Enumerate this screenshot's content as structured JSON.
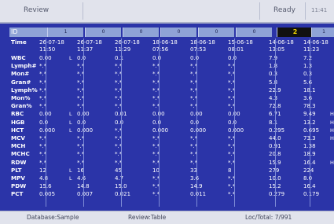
{
  "header": {
    "title": "Review",
    "status": "Ready",
    "time": "11:41"
  },
  "table": {
    "id_label": "ID",
    "ids": [
      "1",
      "0",
      "0",
      "0",
      "0",
      "0",
      "2",
      "1"
    ],
    "selected_index": 6,
    "rows": [
      {
        "param": "Time",
        "values": [
          "26-07-18\n11:50",
          "26-07-18\n11:37",
          "26-07-18\n11:29",
          "18-06-18\n07:56",
          "18-06-18\n07:53",
          "15-06-18\n08:01",
          "14-06-18\n13:05",
          "14-06-18\n11:23"
        ],
        "flags": [
          "",
          "",
          "",
          "",
          "",
          "",
          "",
          ""
        ]
      },
      {
        "param": "WBC",
        "values": [
          "0.00",
          "0.0",
          "0.1",
          "0.0",
          "0.0",
          "0.0",
          "7.9",
          "7.2"
        ],
        "flags": [
          "L",
          "",
          "",
          "",
          "",
          "",
          "",
          ""
        ]
      },
      {
        "param": "Lymph#",
        "values": [
          "*.*",
          "*.*",
          "*.*",
          "*.*",
          "*.*",
          "*.*",
          "1.8",
          "1.3"
        ],
        "flags": [
          "",
          "",
          "",
          "",
          "",
          "",
          "",
          ""
        ]
      },
      {
        "param": "Mon#",
        "values": [
          "*.*",
          "*.*",
          "*.*",
          "*.*",
          "*.*",
          "*.*",
          "0.3",
          "0.3"
        ],
        "flags": [
          "",
          "",
          "",
          "",
          "",
          "",
          "",
          ""
        ]
      },
      {
        "param": "Gran#",
        "values": [
          "*.*",
          "*.*",
          "*.*",
          "*.*",
          "*.*",
          "*.*",
          "5.8",
          "5.6"
        ],
        "flags": [
          "",
          "",
          "",
          "",
          "",
          "",
          "",
          ""
        ]
      },
      {
        "param": "Lymph%",
        "values": [
          "*.*",
          "*.*",
          "*.*",
          "*.*",
          "*.*",
          "*.*",
          "22.9",
          "18.1"
        ],
        "flags": [
          "",
          "",
          "",
          "",
          "",
          "",
          "",
          ""
        ]
      },
      {
        "param": "Mon%",
        "values": [
          "*.*",
          "*.*",
          "*.*",
          "*.*",
          "*.*",
          "*.*",
          "4.3",
          "3.6"
        ],
        "flags": [
          "",
          "",
          "",
          "",
          "",
          "",
          "",
          ""
        ]
      },
      {
        "param": "Gran%",
        "values": [
          "*.*",
          "*.*",
          "*.*",
          "*.*",
          "*.*",
          "*.*",
          "72.8",
          "78.3"
        ],
        "flags": [
          "",
          "",
          "",
          "",
          "",
          "",
          "",
          ""
        ]
      },
      {
        "param": "RBC",
        "values": [
          "0.00",
          "0.00",
          "0.01",
          "0.00",
          "0.00",
          "0.00",
          "6.71",
          "9.49"
        ],
        "flags": [
          "L",
          "",
          "",
          "",
          "",
          "",
          "",
          "H"
        ]
      },
      {
        "param": "HGB",
        "values": [
          "0.0",
          "0.0",
          "0.0",
          "0.0",
          "0.0",
          "0.0",
          "8.1",
          "13.2"
        ],
        "flags": [
          "L",
          "",
          "",
          "",
          "",
          "",
          "",
          "H"
        ]
      },
      {
        "param": "HCT",
        "values": [
          "0.000",
          "0.000",
          "*.*",
          "0.000",
          "0.000",
          "0.000",
          "0.295",
          "0.695"
        ],
        "flags": [
          "L",
          "",
          "",
          "",
          "",
          "",
          "",
          "H"
        ]
      },
      {
        "param": "MCV",
        "values": [
          "*.*",
          "*.*",
          "*.*",
          "*.*",
          "*.*",
          "*.*",
          "44.0",
          "73.3"
        ],
        "flags": [
          "",
          "",
          "",
          "",
          "",
          "",
          "",
          "H"
        ]
      },
      {
        "param": "MCH",
        "values": [
          "*.*",
          "*.*",
          "*.*",
          "*.*",
          "*.*",
          "*.*",
          "0.91",
          "1.38"
        ],
        "flags": [
          "",
          "",
          "",
          "",
          "",
          "",
          "",
          ""
        ]
      },
      {
        "param": "MCHC",
        "values": [
          "*.*",
          "*.*",
          "*.*",
          "*.*",
          "*.*",
          "*.*",
          "20.8",
          "18.9"
        ],
        "flags": [
          "",
          "",
          "",
          "",
          "",
          "",
          "",
          ""
        ]
      },
      {
        "param": "RDW",
        "values": [
          "*.*",
          "*.*",
          "*.*",
          "*.*",
          "*.*",
          "*.*",
          "15.9",
          "16.4"
        ],
        "flags": [
          "",
          "",
          "",
          "",
          "",
          "",
          "",
          "H"
        ]
      },
      {
        "param": "PLT",
        "values": [
          "12",
          "16",
          "45",
          "10",
          "33",
          "8",
          "279",
          "224"
        ],
        "flags": [
          "L",
          "",
          "",
          "",
          "",
          "",
          "",
          ""
        ]
      },
      {
        "param": "MPV",
        "values": [
          "4.8",
          "4.6",
          "4.7",
          "*.*",
          "3.6",
          "*.*",
          "10.0",
          "8.0"
        ],
        "flags": [
          "L",
          "",
          "",
          "",
          "",
          "",
          "",
          ""
        ]
      },
      {
        "param": "PDW",
        "values": [
          "15.6",
          "14.8",
          "15.0",
          "*.*",
          "14.9",
          "*.*",
          "15.2",
          "16.4"
        ],
        "flags": [
          "",
          "",
          "",
          "",
          "",
          "",
          "",
          ""
        ]
      },
      {
        "param": "PCT",
        "values": [
          "0.005",
          "0.007",
          "0.021",
          "*.*",
          "0.011",
          "*.*",
          "0.279",
          "0.179"
        ],
        "flags": [
          "",
          "",
          "",
          "",
          "",
          "",
          "",
          ""
        ]
      }
    ]
  },
  "footer": {
    "database": "Database:Sample",
    "review": "Review:Table",
    "loc_total": "Loc/Total: 7/991"
  }
}
